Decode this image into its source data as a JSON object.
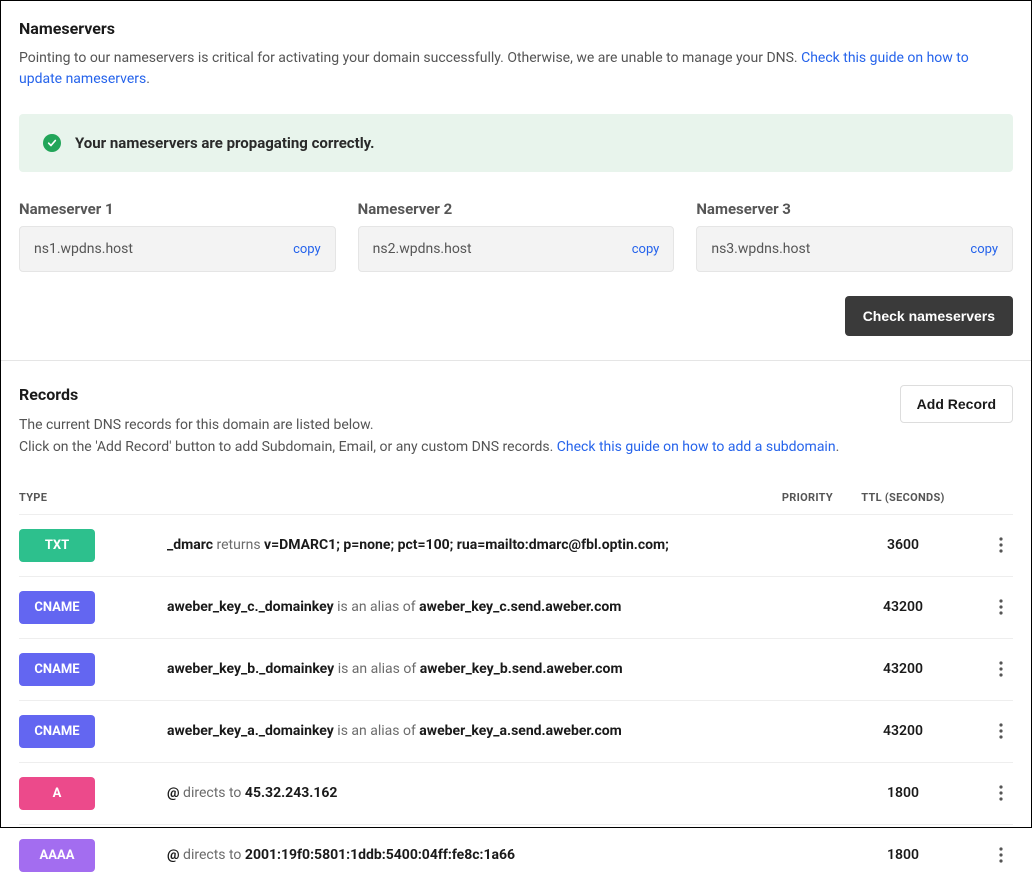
{
  "nameservers": {
    "title": "Nameservers",
    "desc_prefix": "Pointing to our nameservers is critical for activating your domain successfully. Otherwise, we are unable to manage your DNS. ",
    "desc_link": "Check this guide on how to update nameservers",
    "desc_suffix": ".",
    "status": "Your nameservers are propagating correctly.",
    "entries": [
      {
        "label": "Nameserver 1",
        "value": "ns1.wpdns.host",
        "copy": "copy"
      },
      {
        "label": "Nameserver 2",
        "value": "ns2.wpdns.host",
        "copy": "copy"
      },
      {
        "label": "Nameserver 3",
        "value": "ns3.wpdns.host",
        "copy": "copy"
      }
    ],
    "check_btn": "Check nameservers"
  },
  "records": {
    "title": "Records",
    "desc_line1": "The current DNS records for this domain are listed below.",
    "desc_line2_prefix": "Click on the 'Add Record' button to add Subdomain, Email, or any custom DNS records. ",
    "desc_line2_link": "Check this guide on how to add a subdomain",
    "desc_line2_suffix": ".",
    "add_btn": "Add Record",
    "headers": {
      "type": "TYPE",
      "priority": "PRIORITY",
      "ttl": "TTL (SECONDS)"
    },
    "rows": [
      {
        "type": "TXT",
        "badge_class": "badge-txt",
        "name": "_dmarc",
        "action": "returns",
        "target": "v=DMARC1; p=none; pct=100; rua=mailto:dmarc@fbl.optin.com;",
        "priority": "",
        "ttl": "3600"
      },
      {
        "type": "CNAME",
        "badge_class": "badge-cname",
        "name": "aweber_key_c._domainkey",
        "action": "is an alias of",
        "target": "aweber_key_c.send.aweber.com",
        "priority": "",
        "ttl": "43200"
      },
      {
        "type": "CNAME",
        "badge_class": "badge-cname",
        "name": "aweber_key_b._domainkey",
        "action": "is an alias of",
        "target": "aweber_key_b.send.aweber.com",
        "priority": "",
        "ttl": "43200"
      },
      {
        "type": "CNAME",
        "badge_class": "badge-cname",
        "name": "aweber_key_a._domainkey",
        "action": "is an alias of",
        "target": "aweber_key_a.send.aweber.com",
        "priority": "",
        "ttl": "43200"
      },
      {
        "type": "A",
        "badge_class": "badge-a",
        "name": "@",
        "action": "directs to",
        "target": "45.32.243.162",
        "priority": "",
        "ttl": "1800"
      },
      {
        "type": "AAAA",
        "badge_class": "badge-aaaa",
        "name": "@",
        "action": "directs to",
        "target": "2001:19f0:5801:1ddb:5400:04ff:fe8c:1a66",
        "priority": "",
        "ttl": "1800"
      }
    ]
  }
}
